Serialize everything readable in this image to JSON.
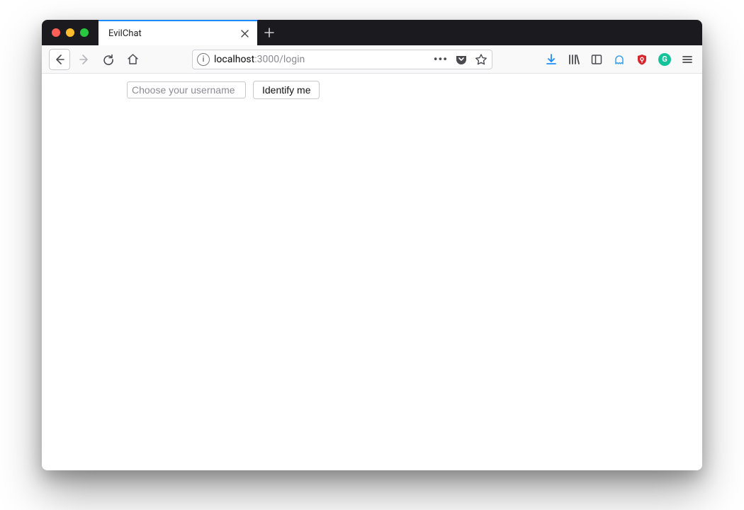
{
  "window": {
    "tab_title": "EvilChat"
  },
  "urlbar": {
    "host": "localhost",
    "port_path": ":3000/login",
    "page_actions_label": "…"
  },
  "content": {
    "username_placeholder": "Choose your username",
    "username_value": "",
    "identify_button": "Identify me"
  },
  "colors": {
    "tab_active_accent": "#1a8cff",
    "download_icon": "#1a8cff",
    "ublock_icon": "#d7262d",
    "grammarly_icon": "#15c39a",
    "ghostery_icon": "#3aa0ea"
  }
}
